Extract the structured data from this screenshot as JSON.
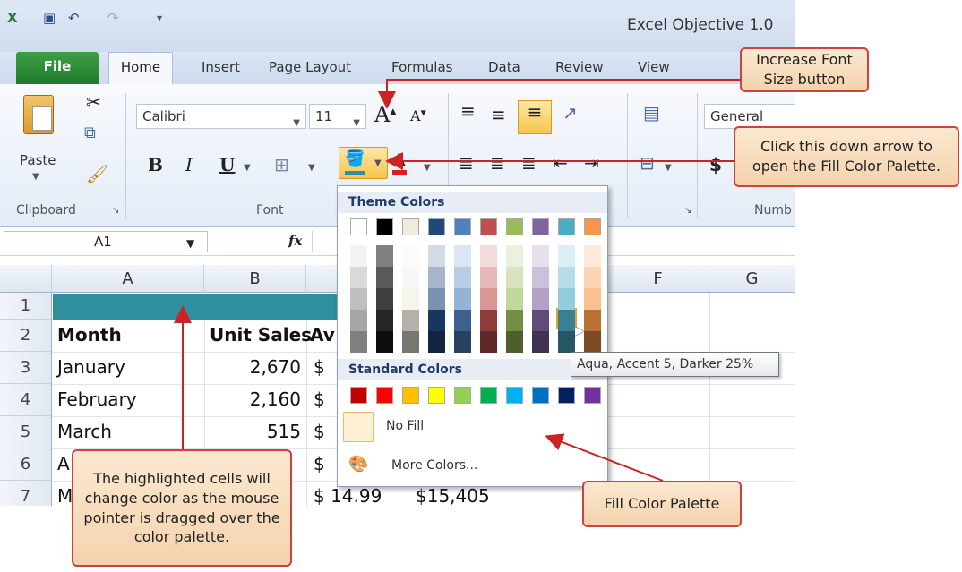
{
  "window": {
    "title": "Excel Objective 1.0"
  },
  "ribbon_tabs": [
    "File",
    "Home",
    "Insert",
    "Page Layout",
    "Formulas",
    "Data",
    "Review",
    "View"
  ],
  "ribbon": {
    "paste_label": "Paste",
    "font_name": "Calibri",
    "font_size": "11",
    "bold": "B",
    "italic": "I",
    "underline": "U",
    "number_format": "General",
    "currency_symbol": "$",
    "groups": {
      "clipboard": "Clipboard",
      "font": "Font",
      "number": "Numb"
    }
  },
  "formula_bar": {
    "name_box": "A1",
    "fx": "fx"
  },
  "sheet": {
    "columns": [
      "A",
      "B",
      "F",
      "G"
    ],
    "rows": [
      "1",
      "2",
      "3",
      "4",
      "5",
      "6",
      "7"
    ],
    "header_row": {
      "a": "Month",
      "b": "Unit Sales",
      "c": "Av"
    },
    "data": [
      {
        "month": "January",
        "sales": "2,670",
        "cur": "$"
      },
      {
        "month": "February",
        "sales": "2,160",
        "cur": "$"
      },
      {
        "month": "March",
        "sales": "515",
        "cur": "$"
      },
      {
        "month": "A",
        "sales": "",
        "cur": "$"
      },
      {
        "month": "M",
        "sales": "",
        "cur": "$ 14.99",
        "extra": "$15,405"
      }
    ],
    "highlight_color": "#2f8f9d"
  },
  "palette": {
    "theme_title": "Theme Colors",
    "standard_title": "Standard Colors",
    "no_fill": "No Fill",
    "more_colors": "More Colors...",
    "tooltip": "Aqua, Accent 5, Darker 25%",
    "theme_base": [
      "#ffffff",
      "#000000",
      "#eeece1",
      "#1f497d",
      "#4f81bd",
      "#c0504d",
      "#9bbb59",
      "#8064a2",
      "#4bacc6",
      "#f79646"
    ],
    "standard": [
      "#c00000",
      "#ff0000",
      "#ffc000",
      "#ffff00",
      "#92d050",
      "#00b050",
      "#00b0f0",
      "#0070c0",
      "#002060",
      "#7030a0"
    ]
  },
  "callouts": {
    "font_size": "Increase Font Size button",
    "fill_arrow": "Click this down arrow to open the Fill Color Palette.",
    "highlight": "The highlighted cells will change color as the mouse pointer is dragged over the color palette.",
    "palette": "Fill Color Palette"
  },
  "colors": {
    "callout_border": "#d04040",
    "callout_fill": "#f7dcbc",
    "excel_green": "#217346"
  }
}
